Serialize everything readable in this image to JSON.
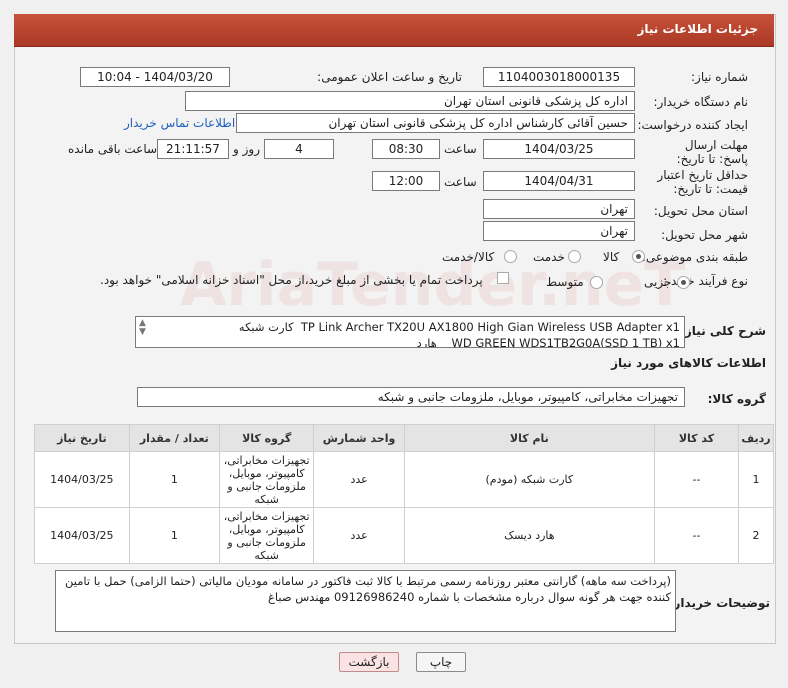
{
  "header": {
    "title": "جزئیات اطلاعات نیاز"
  },
  "watermark": "AriaTender.neT",
  "fields": {
    "need_number_label": "شماره نیاز:",
    "need_number": "1104003018000135",
    "announce_label": "تاریخ و ساعت اعلان عمومی:",
    "announce_value": "1404/03/20 - 10:04",
    "buyer_org_label": "نام دستگاه خریدار:",
    "buyer_org": "اداره کل پزشکی قانونی استان تهران",
    "creator_label": "ایجاد کننده درخواست:",
    "creator": "حسین آقائی کارشناس اداره کل پزشکی قانونی استان تهران",
    "contact_link": "اطلاعات تماس خریدار",
    "reply_deadline_label": "مهلت ارسال پاسخ: تا تاریخ:",
    "reply_date": "1404/03/25",
    "time_label": "ساعت",
    "reply_time": "08:30",
    "days_value": "4",
    "days_label": "روز و",
    "remaining_time": "21:11:57",
    "remaining_label": "ساعت باقی مانده",
    "price_validity_label": "حداقل تاریخ اعتبار قیمت: تا تاریخ:",
    "price_date": "1404/04/31",
    "price_time": "12:00",
    "province_label": "استان محل تحویل:",
    "province": "تهران",
    "city_label": "شهر محل تحویل:",
    "city": "تهران",
    "category_label": "طبقه بندی موضوعی:",
    "category_options": [
      "کالا",
      "خدمت",
      "کالا/خدمت"
    ],
    "process_label": "نوع فرآیند خرید :",
    "process_options": [
      "جزیی",
      "متوسط"
    ],
    "payment_note": "پرداخت تمام یا بخشی از مبلغ خرید،از محل \"اسناد خزانه اسلامی\" خواهد بود."
  },
  "description": {
    "label": "شرح کلی نیاز:",
    "text": "TP Link Archer TX20U AX1800 High Gian Wireless USB Adapter x1  کارت شبکه\nWD GREEN WDS1TB2G0A(SSD 1 TB) x1    هارد"
  },
  "goods_section": {
    "title": "اطلاعات کالاهای مورد نیاز",
    "group_label": "گروه کالا:",
    "group_value": "تجهیزات مخابراتی، کامپیوتر، موبایل، ملزومات جانبی و شبکه"
  },
  "table": {
    "headers": [
      "ردیف",
      "کد کالا",
      "نام کالا",
      "واحد شمارش",
      "گروه کالا",
      "تعداد / مقدار",
      "تاریخ نیاز"
    ],
    "rows": [
      [
        "1",
        "--",
        "کارت شبکه (مودم)",
        "عدد",
        "تجهیزات مخابراتی، کامپیوتر، موبایل، ملزومات جانبی و شبکه",
        "1",
        "1404/03/25"
      ],
      [
        "2",
        "--",
        "هارد دیسک",
        "عدد",
        "تجهیزات مخابراتی، کامپیوتر، موبایل، ملزومات جانبی و شبکه",
        "1",
        "1404/03/25"
      ]
    ]
  },
  "buyer_notes": {
    "label": "توضیحات خریدار:",
    "text": "(پرداخت سه ماهه) گارانتی معتبر روزنامه رسمی مرتبط با کالا ثبت فاکتور در سامانه مودیان مالیاتی (حتما الزامی) حمل با تامین کننده جهت هر گونه سوال درباره مشخصات با شماره 09126986240 مهندس صباغ"
  },
  "buttons": {
    "print": "چاپ",
    "back": "بازگشت"
  },
  "colors": {
    "header": "#b5432c",
    "link": "#1f5fbf"
  }
}
